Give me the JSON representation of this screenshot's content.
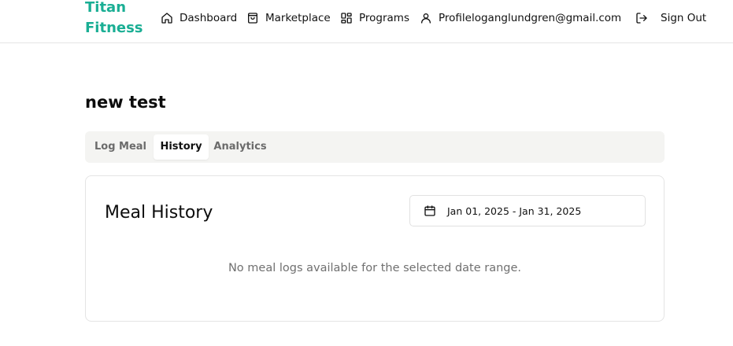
{
  "brand": {
    "line1": "Titan",
    "line2": "Fitness",
    "color": "#1aae94"
  },
  "nav": {
    "dashboard": {
      "label": "Dashboard",
      "icon": "home-icon"
    },
    "marketplace": {
      "label": "Marketplace",
      "icon": "shopping-bag-icon"
    },
    "programs": {
      "label": "Programs",
      "icon": "grid-icon"
    },
    "profile": {
      "label": "Profileloganglundgren@gmail.com",
      "icon": "user-icon"
    },
    "signout": {
      "label": "Sign Out",
      "icon": "log-out-icon"
    }
  },
  "page": {
    "title": "new test"
  },
  "tabs": [
    {
      "label": "Log Meal",
      "active": false
    },
    {
      "label": "History",
      "active": true
    },
    {
      "label": "Analytics",
      "active": false
    }
  ],
  "card": {
    "title": "Meal History",
    "date_range": {
      "value": "Jan 01, 2025 - Jan 31, 2025",
      "icon": "calendar-icon"
    },
    "empty_message": "No meal logs available for the selected date range."
  }
}
